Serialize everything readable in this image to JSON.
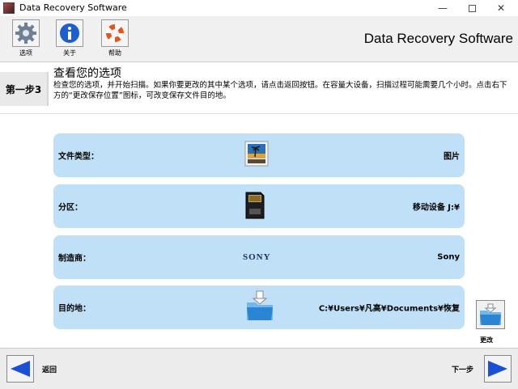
{
  "window": {
    "title": "Data Recovery Software",
    "controls": {
      "minimize": "—",
      "close": "✕"
    }
  },
  "toolbar": {
    "options_label": "选项",
    "about_label": "关于",
    "help_label": "帮助",
    "brand_title": "Data Recovery Software"
  },
  "step": {
    "badge": "第一步3",
    "heading": "查看您的选项",
    "description": "检查您的选项，并开始扫描。如果你要更改的其中某个选项，请点击返回按钮。在容量大设备，扫描过程可能需要几个小时。点击右下方的“更改保存位置”图标，可改变保存文件目的地。"
  },
  "options": {
    "file_type": {
      "label": "文件类型：",
      "value": "图片"
    },
    "partition": {
      "label": "分区：",
      "value": "移动设备 J:¥"
    },
    "manufacturer": {
      "label": "制造商：",
      "value": "Sony",
      "logo_text": "SONY"
    },
    "destination": {
      "label": "目的地：",
      "value": "C:¥Users¥凡高¥Documents¥恢复"
    }
  },
  "change": {
    "label": "更改"
  },
  "nav": {
    "back_label": "返回",
    "next_label": "下一步"
  },
  "colors": {
    "card_bg": "#bfe0f7",
    "nav_arrow": "#1a4fd6",
    "step_accent": "#5aa0d8"
  }
}
